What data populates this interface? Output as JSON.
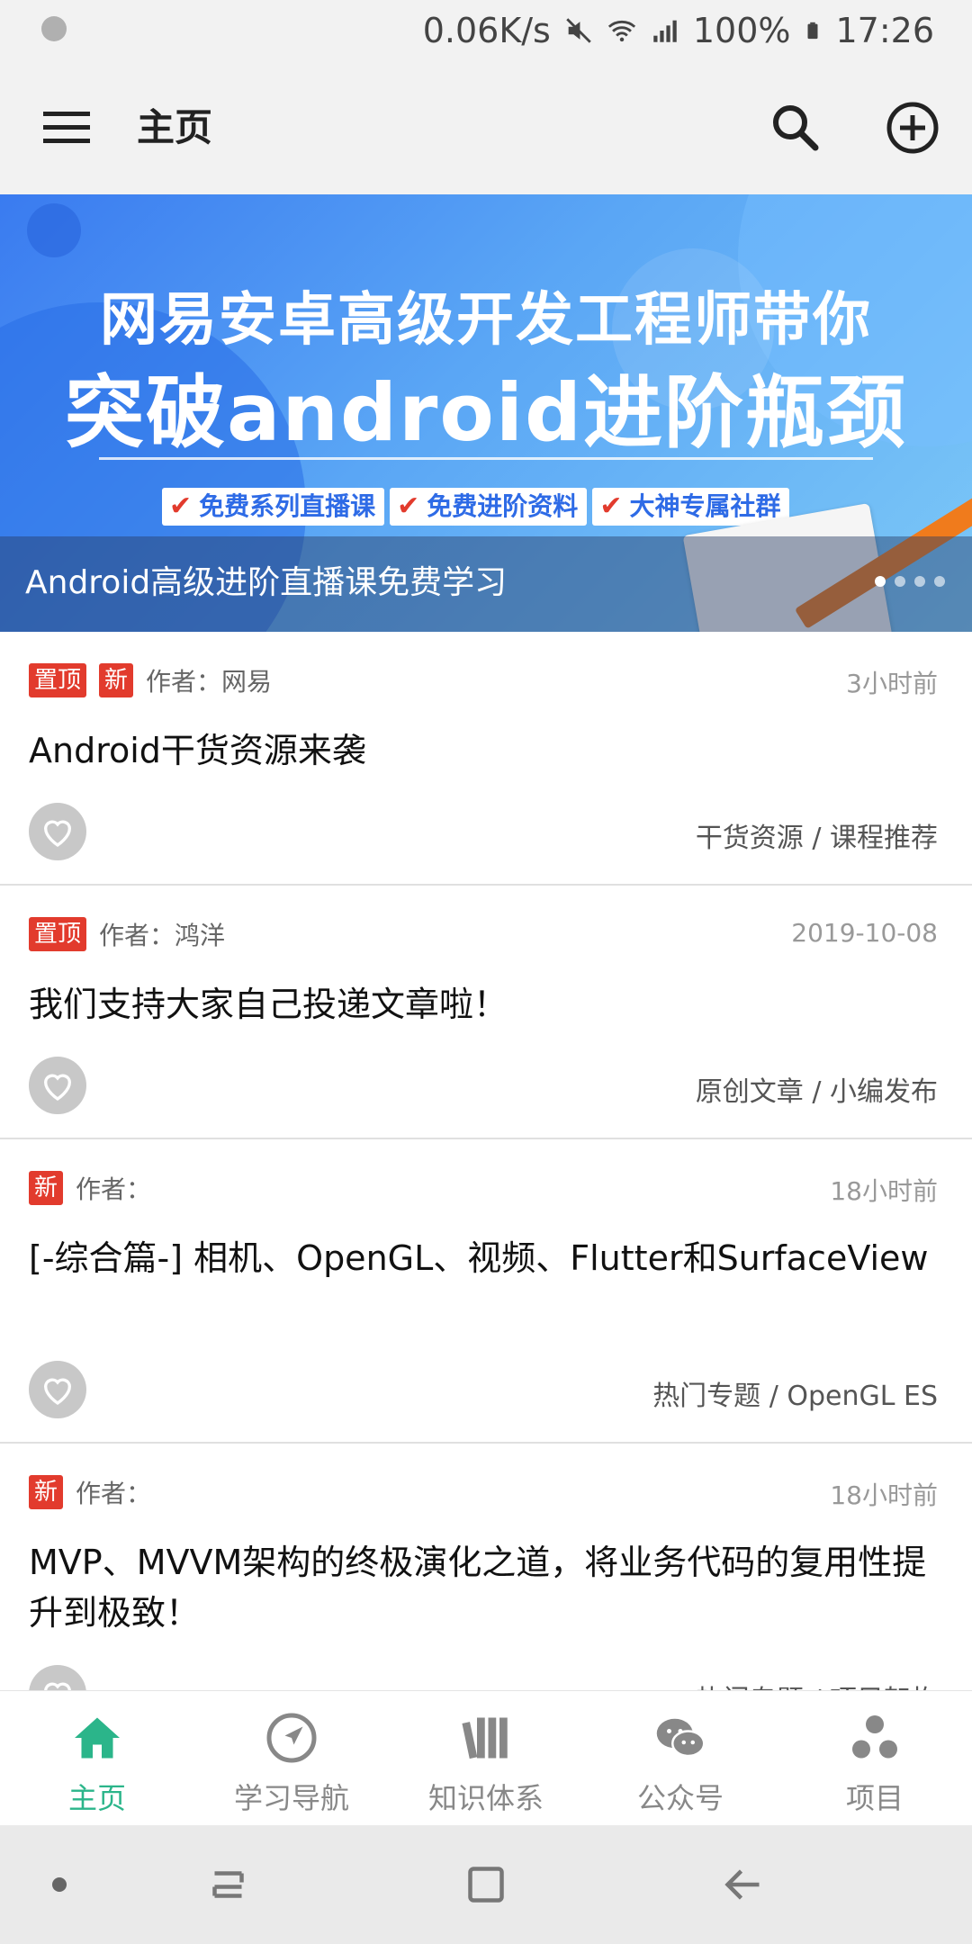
{
  "status_bar": {
    "speed": "0.06K/s",
    "battery": "100%",
    "time": "17:26"
  },
  "toolbar": {
    "title": "主页"
  },
  "banner": {
    "headline_1": "网易安卓高级开发工程师带你",
    "headline_2": "突破android进阶瓶颈",
    "tags": [
      "免费系列直播课",
      "免费进阶资料",
      "大神专属社群"
    ],
    "caption": "Android高级进阶直播课免费学习",
    "page_count": 4,
    "active_page": 0
  },
  "articles": [
    {
      "badges": [
        "置顶",
        "新"
      ],
      "author": "作者：网易",
      "time": "3小时前",
      "title": "Android干货资源来袭",
      "category": "干货资源 / 课程推荐"
    },
    {
      "badges": [
        "置顶"
      ],
      "author": "作者：鸿洋",
      "time": "2019-10-08",
      "title": "我们支持大家自己投递文章啦！",
      "category": "原创文章 / 小编发布"
    },
    {
      "badges": [
        "新"
      ],
      "author": "作者：",
      "time": "18小时前",
      "title": "[-综合篇-] 相机、OpenGL、视频、Flutter和SurfaceView",
      "category": "热门专题 / OpenGL ES"
    },
    {
      "badges": [
        "新"
      ],
      "author": "作者：",
      "time": "18小时前",
      "title": "MVP、MVVM架构的终极演化之道，将业务代码的复用性提升到极致！",
      "category": "热门专题 / 项目架构"
    }
  ],
  "bottom_nav": {
    "items": [
      {
        "label": "主页",
        "icon": "home-icon"
      },
      {
        "label": "学习导航",
        "icon": "navigation-icon"
      },
      {
        "label": "知识体系",
        "icon": "books-icon"
      },
      {
        "label": "公众号",
        "icon": "wechat-icon"
      },
      {
        "label": "项目",
        "icon": "project-icon"
      }
    ],
    "active_index": 0,
    "active_color": "#2bb58a",
    "inactive_color": "#888888"
  },
  "colors": {
    "badge": "#e23b2d",
    "accent": "#2bb58a"
  }
}
